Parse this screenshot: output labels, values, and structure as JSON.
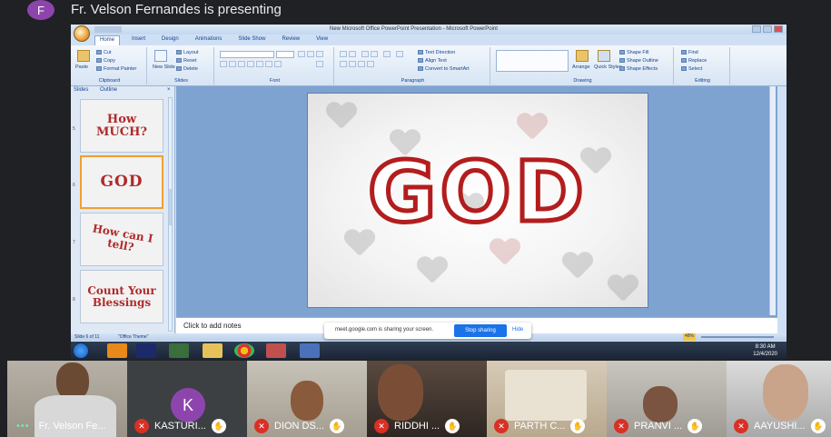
{
  "presenter_banner": {
    "avatar_letter": "F",
    "text": "Fr. Velson Fernandes is presenting"
  },
  "powerpoint": {
    "window_title": "New Microsoft Office PowerPoint Presentation - Microsoft PowerPoint",
    "tabs": [
      "Home",
      "Insert",
      "Design",
      "Animations",
      "Slide Show",
      "Review",
      "View"
    ],
    "ribbon": {
      "clipboard": {
        "label": "Clipboard",
        "paste": "Paste",
        "cut": "Cut",
        "copy": "Copy",
        "format_painter": "Format Painter"
      },
      "slides": {
        "label": "Slides",
        "new_slide": "New Slide",
        "layout": "Layout",
        "reset": "Reset",
        "delete": "Delete"
      },
      "font": {
        "label": "Font"
      },
      "paragraph": {
        "label": "Paragraph",
        "text_direction": "Text Direction",
        "align_text": "Align Text",
        "convert_smartart": "Convert to SmartArt"
      },
      "drawing": {
        "label": "Drawing",
        "arrange": "Arrange",
        "quick_styles": "Quick Styles",
        "shape_fill": "Shape Fill",
        "shape_outline": "Shape Outline",
        "shape_effects": "Shape Effects"
      },
      "editing": {
        "label": "Editing",
        "find": "Find",
        "replace": "Replace",
        "select": "Select"
      }
    },
    "pane_tabs": {
      "slides": "Slides",
      "outline": "Outline"
    },
    "thumbnails": [
      {
        "number": "5",
        "text": "How MUCH?"
      },
      {
        "number": "6",
        "text": "GOD"
      },
      {
        "number": "7",
        "text": "How can I tell?"
      },
      {
        "number": "8",
        "text": "Count Your Blessings"
      }
    ],
    "slide_text": "GOD",
    "notes_placeholder": "Click to add notes",
    "status": {
      "slide_info": "Slide 6 of 11",
      "theme": "\"Office Theme\"",
      "zoom": "48%"
    },
    "tray": {
      "time": "8:30 AM",
      "date": "12/4/2020"
    }
  },
  "share_bar": {
    "message": "meet.google.com is sharing your screen.",
    "stop_label": "Stop sharing",
    "hide_label": "Hide"
  },
  "participants": [
    {
      "name": "Fr. Velson Fe...",
      "muted": false,
      "hand": false
    },
    {
      "name": "KASTURI...",
      "muted": true,
      "hand": true,
      "avatar_letter": "K"
    },
    {
      "name": "DION DS...",
      "muted": true,
      "hand": true
    },
    {
      "name": "RIDDHI ...",
      "muted": true,
      "hand": true
    },
    {
      "name": "PARTH C...",
      "muted": true,
      "hand": true
    },
    {
      "name": "PRANVI ...",
      "muted": true,
      "hand": true
    },
    {
      "name": "AAYUSHI...",
      "muted": true,
      "hand": true
    }
  ],
  "colors": {
    "meet_background": "#202124",
    "avatar_purple": "#8e44ad",
    "mute_red": "#d93025",
    "stop_blue": "#1a73e8",
    "god_red": "#b31d1d",
    "thumb_selected": "#f0a030"
  }
}
